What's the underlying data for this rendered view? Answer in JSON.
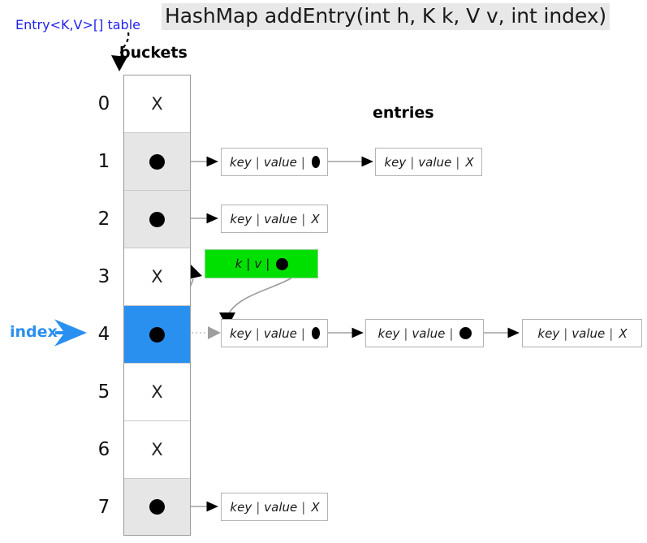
{
  "title": "HashMap addEntry(int h, K k, V v, int index)",
  "labels": {
    "table_ref": "Entry<K,V>[] table",
    "buckets": "buckets",
    "entries": "entries",
    "index": "index"
  },
  "colors": {
    "table_ref": "#2222ee",
    "index_accent": "#2a90ef",
    "new_entry_fill": "#00e000",
    "filled_cell": "#e6e6e6",
    "title_bg": "#e8e8e8"
  },
  "buckets": [
    {
      "index": "0",
      "state": "empty",
      "mark": "X"
    },
    {
      "index": "1",
      "state": "filled",
      "mark": "dot"
    },
    {
      "index": "2",
      "state": "filled",
      "mark": "dot"
    },
    {
      "index": "3",
      "state": "empty",
      "mark": "X"
    },
    {
      "index": "4",
      "state": "target",
      "mark": "dot"
    },
    {
      "index": "5",
      "state": "empty",
      "mark": "X"
    },
    {
      "index": "6",
      "state": "empty",
      "mark": "X"
    },
    {
      "index": "7",
      "state": "filled",
      "mark": "dot"
    }
  ],
  "entry_text": {
    "key": "key",
    "value": "value",
    "sep": "|",
    "terminator": "X",
    "new_key": "k",
    "new_value": "v"
  },
  "chains": {
    "bucket1": [
      {
        "key": "key",
        "value": "value",
        "next": "dot"
      },
      {
        "key": "key",
        "value": "value",
        "next": "X"
      }
    ],
    "bucket2": [
      {
        "key": "key",
        "value": "value",
        "next": "X"
      }
    ],
    "bucket4": [
      {
        "key": "key",
        "value": "value",
        "next": "dot"
      },
      {
        "key": "key",
        "value": "value",
        "next": "dot"
      },
      {
        "key": "key",
        "value": "value",
        "next": "X"
      }
    ],
    "bucket7": [
      {
        "key": "key",
        "value": "value",
        "next": "X"
      }
    ],
    "new_entry": {
      "key": "k",
      "value": "v",
      "next": "dot"
    }
  }
}
